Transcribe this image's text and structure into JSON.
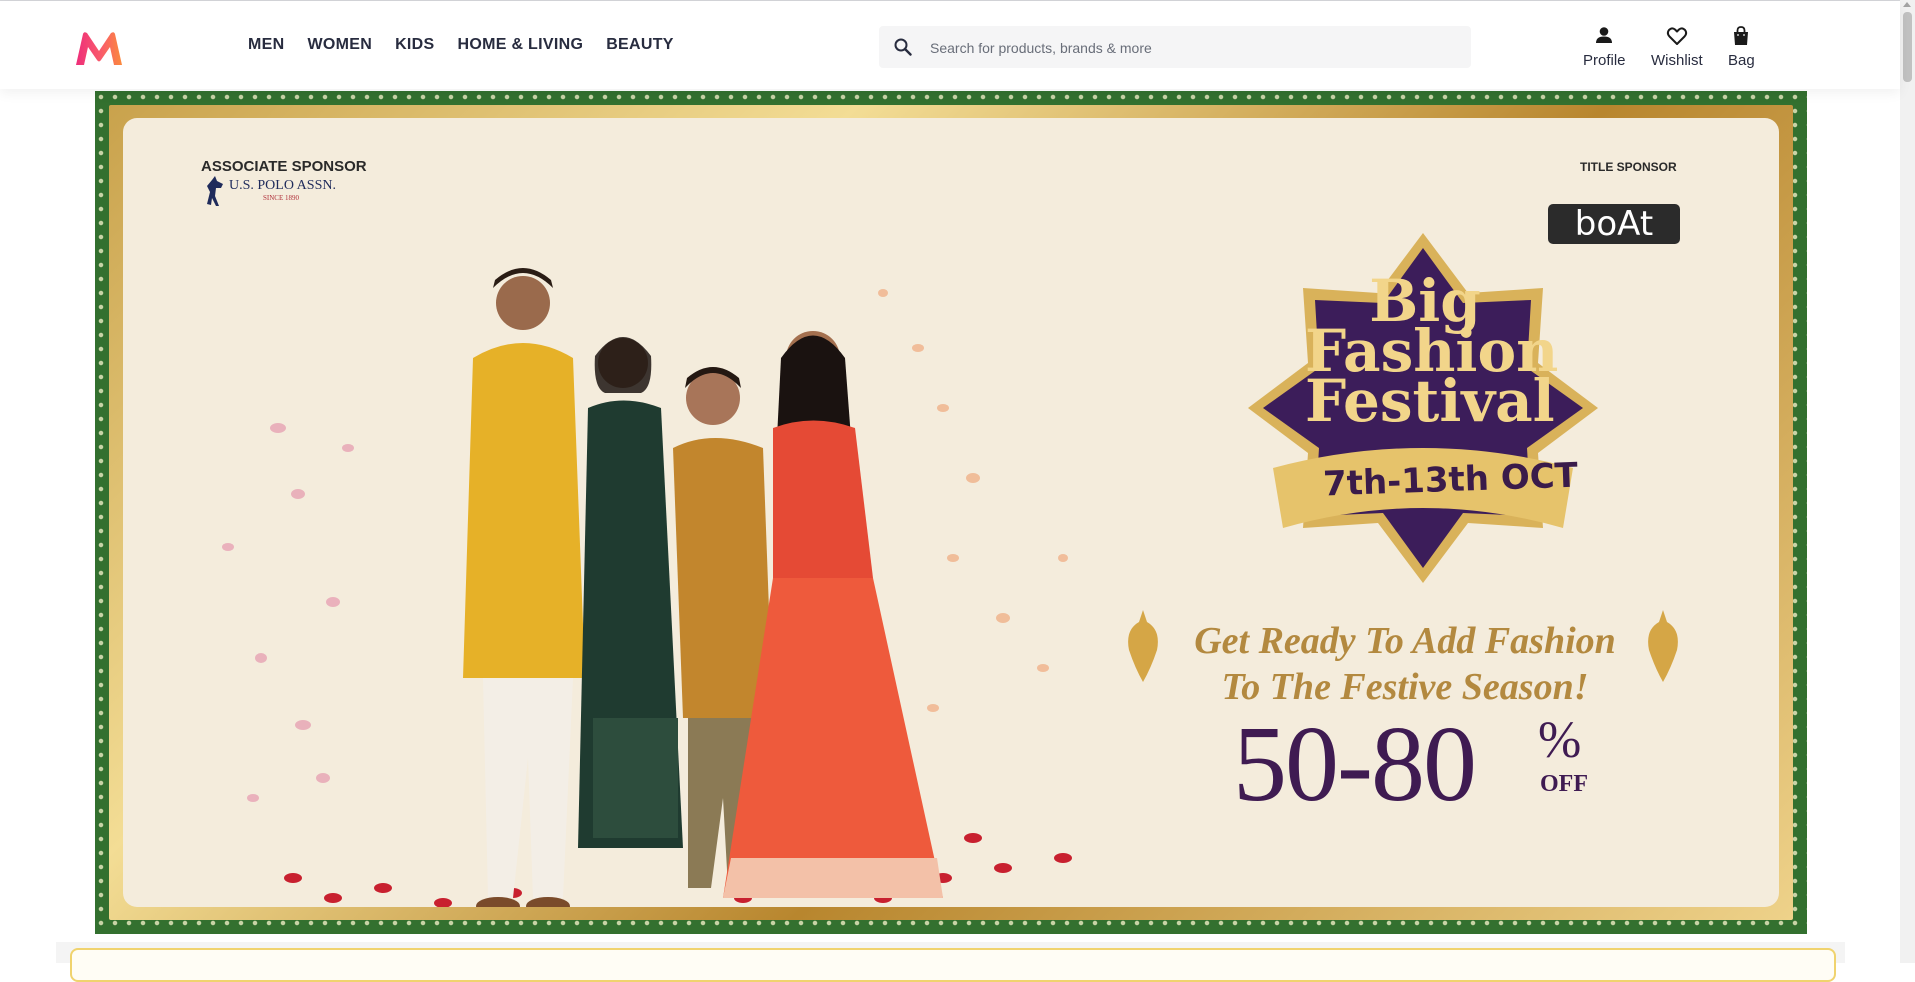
{
  "header": {
    "logo_icon": "myntra-logo-icon",
    "nav": [
      "MEN",
      "WOMEN",
      "KIDS",
      "HOME & LIVING",
      "BEAUTY"
    ],
    "search_placeholder": "Search for products, brands & more",
    "actions": [
      {
        "label": "Profile",
        "icon": "profile-icon"
      },
      {
        "label": "Wishlist",
        "icon": "heart-icon"
      },
      {
        "label": "Bag",
        "icon": "bag-icon"
      }
    ]
  },
  "banner": {
    "associate_label": "ASSOCIATE SPONSOR",
    "associate_brand": "U.S. POLO ASSN.",
    "associate_since": "SINCE 1890",
    "title_label": "TITLE SPONSOR",
    "title_brand": "boAt",
    "festival_line1": "Big",
    "festival_line2": "Fashion",
    "festival_line3": "Festival",
    "dates": "7th-13th OCT",
    "tagline_line1": "Get Ready To Add Fashion",
    "tagline_line2": "To The Festive Season!",
    "discount": "50-80",
    "percent": "%",
    "off": "OFF"
  },
  "colors": {
    "brand_dark": "#282c3f",
    "purple": "#3f1b52",
    "gold": "#c9a24c",
    "frame_green": "#33702f",
    "cream": "#f4ecdc"
  }
}
